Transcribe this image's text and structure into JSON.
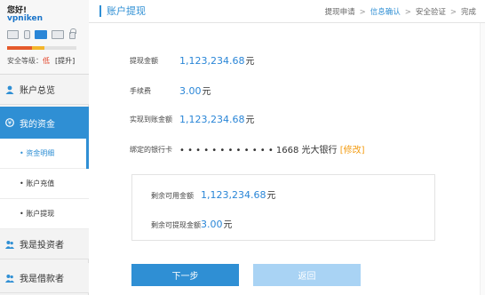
{
  "user": {
    "greeting": "您好!",
    "username": "vpniken",
    "security_label": "安全等级：",
    "security_level": "低",
    "upgrade": "[提升]",
    "icons": [
      "id-card-icon",
      "phone-icon",
      "mail-icon",
      "bank-card-icon",
      "lock-icon"
    ]
  },
  "sidebar": {
    "overview": "账户总览",
    "funds": "我的资金",
    "sub_items": [
      "资金明细",
      "账户充值",
      "账户提现"
    ],
    "investor": "我是投资者",
    "borrower": "我是借款者"
  },
  "header": {
    "title": "账户提现",
    "steps": [
      "提现申请",
      "信息确认",
      "安全验证",
      "完成"
    ],
    "current_step": "信息确认"
  },
  "form": {
    "amount_label": "提现金额",
    "amount_value": "1,123,234.68",
    "fee_label": "手续费",
    "fee_value": "3.00",
    "received_label": "实现到账金额",
    "received_value": "1,123,234.68",
    "unit": "元",
    "card_label": "绑定的银行卡",
    "card_masked": "• • • • • • • • • • • • 1668 光大银行",
    "modify": "[修改]"
  },
  "summary": {
    "available_label": "剩余可用金额",
    "available_value": "1,123,234.68",
    "withdrawable_label": "剩余可提现金额",
    "withdrawable_value": "3.00",
    "unit": "元"
  },
  "buttons": {
    "next": "下一步",
    "back": "返回"
  },
  "colors": {
    "accent": "#2f8fd4",
    "warning": "#e23b1f",
    "modify": "#f39c12"
  }
}
